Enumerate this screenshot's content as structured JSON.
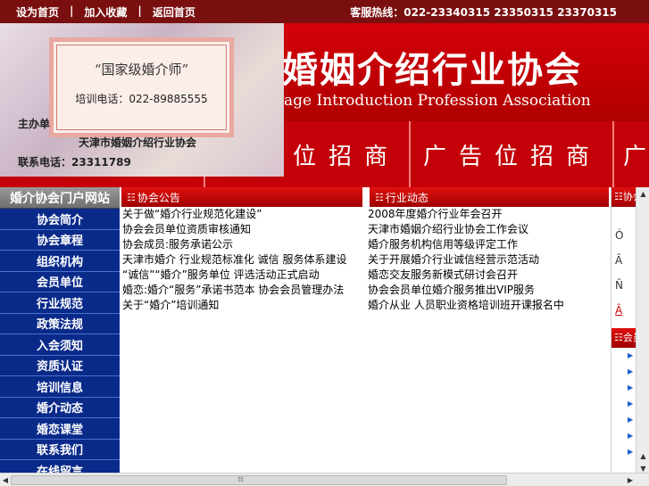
{
  "topbar": {
    "links": [
      "设为首页",
      "加入收藏",
      "返回首页"
    ],
    "separator": "|",
    "hotline": "客服热线：022-23340315 23350315 23370315"
  },
  "banner": {
    "title": "婚姻介绍行业协会",
    "subtitle_en": "age Introduction Profession Association",
    "quote_left": "“",
    "quote_right": "会”"
  },
  "nav": {
    "items": [
      "位招商",
      "广告位招商",
      "广"
    ]
  },
  "popup": {
    "cert_title": "“国家级婚介师”",
    "cert_phone": "培训电话：022-89885555",
    "host_label": "主办单",
    "association": "天津市婚姻介绍行业协会",
    "contact": "联系电话：23311789"
  },
  "sidebar": {
    "heading": "婚介协会门户网站",
    "items": [
      "协会简介",
      "协会章程",
      "组织机构",
      "会员单位",
      "行业规范",
      "政策法规",
      "入会须知",
      "资质认证",
      "培训信息",
      "婚介动态",
      "婚恋课堂",
      "联系我们",
      "在线留言"
    ]
  },
  "panels": {
    "left": {
      "title": "协会公告",
      "lines": [
        "关于做“婚介行业规范化建设”",
        "协会会员单位资质审核通知",
        "协会成员:服务承诺公示",
        "天津市婚介 行业规范标准化 诚信 服务体系建设",
        "“诚信”“婚介”服务单位 评选活动正式启动",
        "婚恋:婚介“服务”承诺书范本 协会会员管理办法",
        "关于“婚介”培训通知"
      ]
    },
    "middle": {
      "title": "行业动态",
      "lines": [
        "2008年度婚介行业年会召开",
        "天津市婚姻介绍行业协会工作会议",
        "婚介服务机构信用等级评定工作",
        "关于开展婚介行业诚信经营示范活动",
        "婚恋交友服务新模式研讨会召开",
        "协会会员单位婚介服务推出VIP服务",
        "婚介从业 人员职业资格培训班开课报名中"
      ]
    },
    "right": {
      "title": "协会",
      "texts": [
        "Ó",
        "Ã",
        "Ñ",
        "Â"
      ],
      "title2": "会员"
    }
  },
  "colors": {
    "topbar": "#7a0f0f",
    "banner_red": "#c40008",
    "sidebar_blue": "#0a2a8a"
  }
}
